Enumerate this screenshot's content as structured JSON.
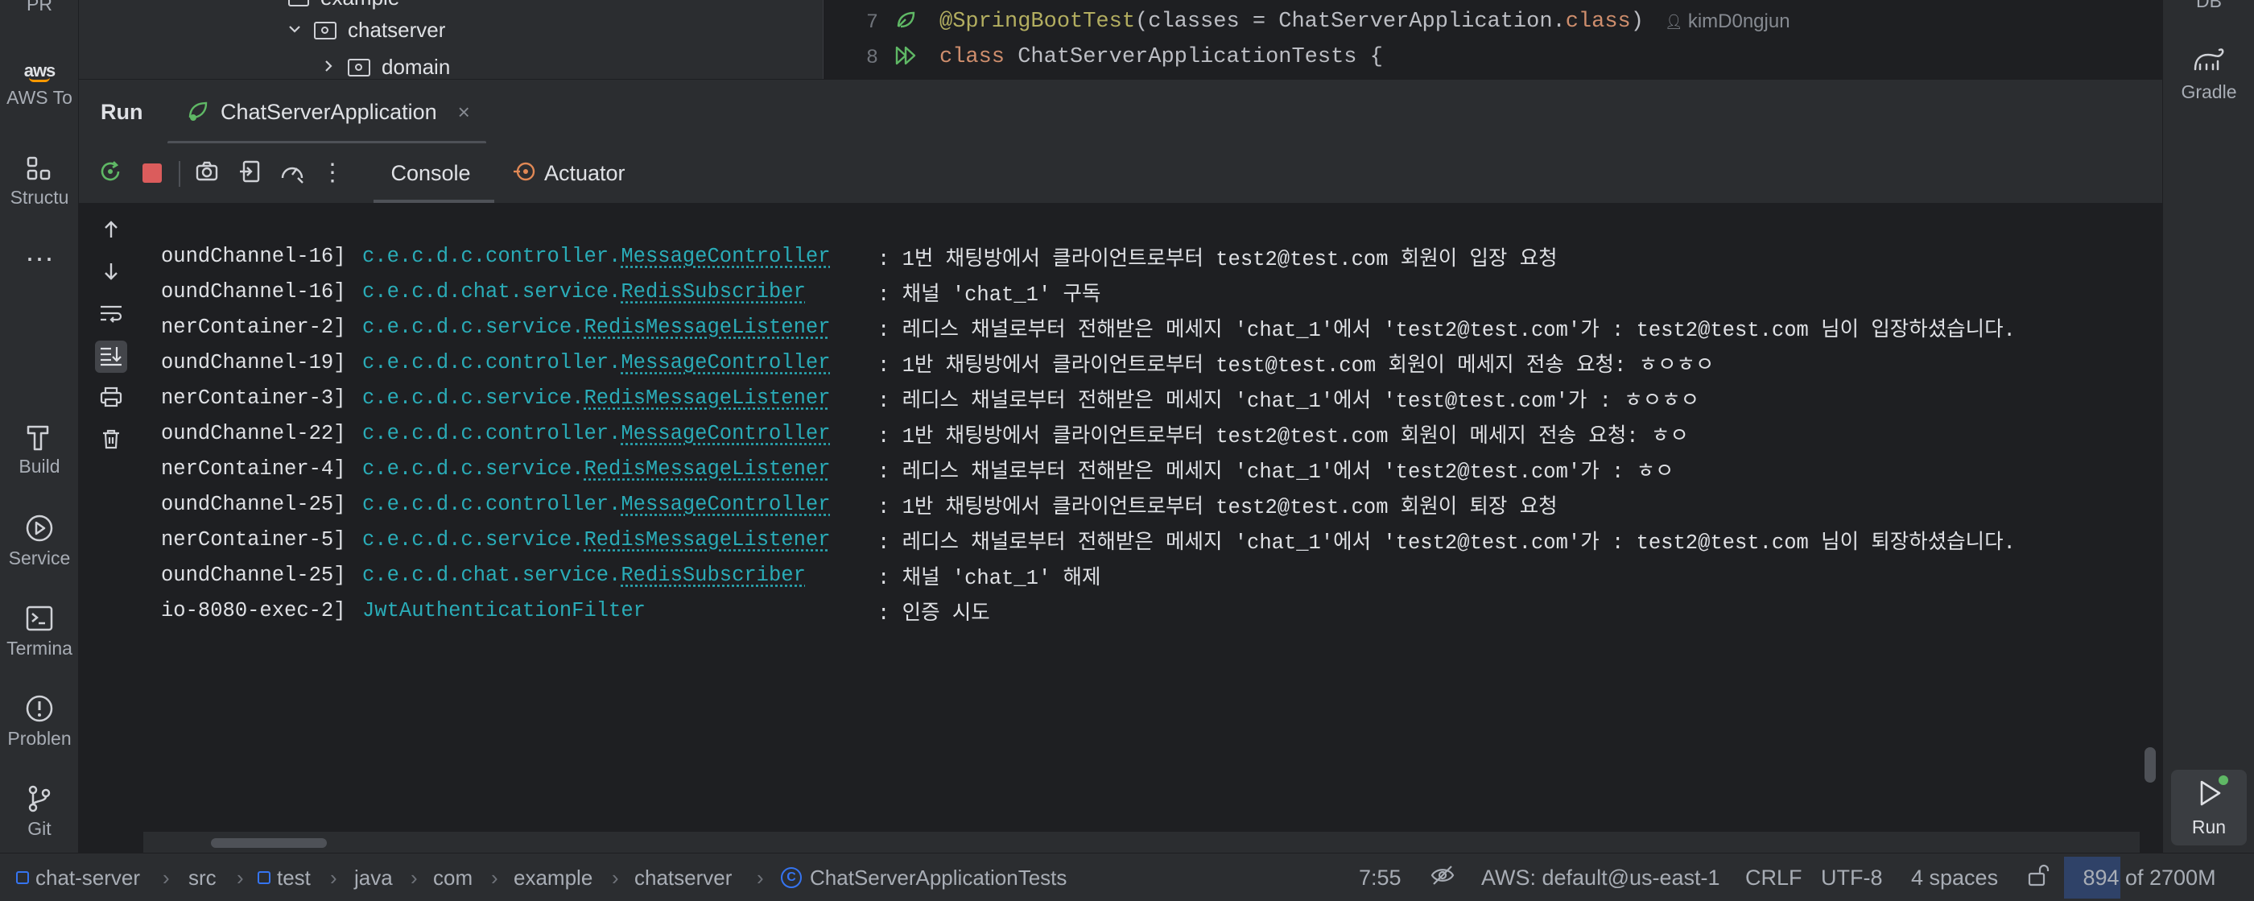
{
  "left_strip": {
    "pr_label": "PR",
    "aws_logo_text": "aws",
    "aws_label": "AWS To",
    "structure_label": "Structu",
    "build_label": "Build",
    "services_label": "Service",
    "terminal_label": "Termina",
    "problems_label": "Problen",
    "git_label": "Git"
  },
  "right_strip": {
    "db_label": "DB",
    "gradle_label": "Gradle",
    "run_label": "Run"
  },
  "tree": {
    "partial_label": "example",
    "rows": [
      {
        "label": "chatserver"
      },
      {
        "label": "domain"
      }
    ]
  },
  "editor": {
    "lines": [
      {
        "number": "7",
        "annotation": "@SpringBootTest",
        "paren_open": "(classes = ChatServerApplication.",
        "keyword": "class",
        "paren_close": ")",
        "author": "kimD0ngjun"
      },
      {
        "number": "8",
        "keyword": "class",
        "rest": " ChatServerApplicationTests {"
      }
    ]
  },
  "run_window": {
    "title": "Run",
    "tab_label": "ChatServerApplication",
    "console_tab": "Console",
    "actuator_tab": "Actuator"
  },
  "log": [
    {
      "thread": "oundChannel-16]",
      "pkg": "c.e.c.d.c.controller.",
      "cls": "MessageController",
      "msg": ": 1번 채팅방에서 클라이언트로부터 test2@test.com 회원이 입장 요청"
    },
    {
      "thread": "oundChannel-16]",
      "pkg": "c.e.c.d.chat.service.",
      "cls": "RedisSubscriber",
      "msg": ": 채널 'chat_1' 구독"
    },
    {
      "thread": "nerContainer-2]",
      "pkg": "c.e.c.d.c.service.",
      "cls": "RedisMessageListener",
      "msg": ": 레디스 채널로부터 전해받은 메세지 'chat_1'에서 'test2@test.com'가 : test2@test.com 님이 입장하셨습니다."
    },
    {
      "thread": "oundChannel-19]",
      "pkg": "c.e.c.d.c.controller.",
      "cls": "MessageController",
      "msg": ": 1반 채팅방에서 클라이언트로부터 test@test.com 회원이 메세지 전송 요청: ㅎㅇㅎㅇ"
    },
    {
      "thread": "nerContainer-3]",
      "pkg": "c.e.c.d.c.service.",
      "cls": "RedisMessageListener",
      "msg": ": 레디스 채널로부터 전해받은 메세지 'chat_1'에서 'test@test.com'가 : ㅎㅇㅎㅇ"
    },
    {
      "thread": "oundChannel-22]",
      "pkg": "c.e.c.d.c.controller.",
      "cls": "MessageController",
      "msg": ": 1반 채팅방에서 클라이언트로부터 test2@test.com 회원이 메세지 전송 요청: ㅎㅇ"
    },
    {
      "thread": "nerContainer-4]",
      "pkg": "c.e.c.d.c.service.",
      "cls": "RedisMessageListener",
      "msg": ": 레디스 채널로부터 전해받은 메세지 'chat_1'에서 'test2@test.com'가 : ㅎㅇ"
    },
    {
      "thread": "oundChannel-25]",
      "pkg": "c.e.c.d.c.controller.",
      "cls": "MessageController",
      "msg": ": 1반 채팅방에서 클라이언트로부터 test2@test.com 회원이 퇴장 요청"
    },
    {
      "thread": "nerContainer-5]",
      "pkg": "c.e.c.d.c.service.",
      "cls": "RedisMessageListener",
      "msg": ": 레디스 채널로부터 전해받은 메세지 'chat_1'에서 'test2@test.com'가 : test2@test.com 님이 퇴장하셨습니다."
    },
    {
      "thread": "oundChannel-25]",
      "pkg": "c.e.c.d.chat.service.",
      "cls": "RedisSubscriber",
      "msg": ": 채널 'chat_1' 해제"
    },
    {
      "thread": "io-8080-exec-2]",
      "pkg": "JwtAuthenticationFilter",
      "cls": "",
      "msg": ": 인증 시도"
    }
  ],
  "breadcrumbs": [
    "chat-server",
    "src",
    "test",
    "java",
    "com",
    "example",
    "chatserver",
    "ChatServerApplicationTests"
  ],
  "status": {
    "position": "7:55",
    "aws": "AWS: default@us-east-1",
    "line_sep": "CRLF",
    "encoding": "UTF-8",
    "indent": "4 spaces",
    "memory": "894 of 2700M",
    "memory_fraction": 0.33
  },
  "colors": {
    "accent": "#3574f0",
    "stop": "#db5c5c",
    "logger": "#2aacb8",
    "annotation": "#b3ae60",
    "keyword": "#cf8e6d",
    "run_green": "#5fb865"
  }
}
